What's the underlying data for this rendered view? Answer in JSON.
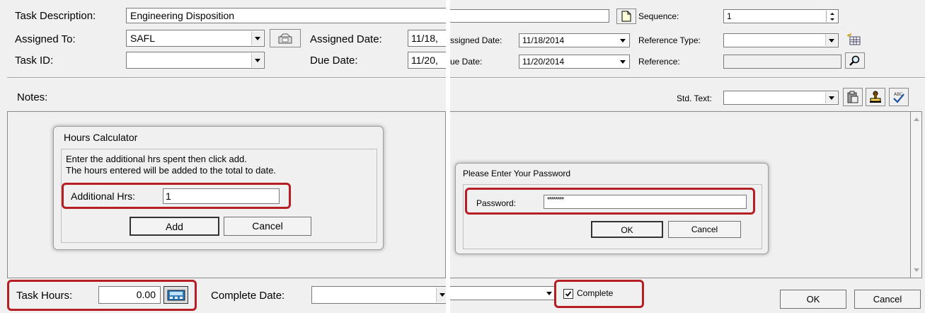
{
  "left": {
    "task_description_label": "Task Description:",
    "task_description_value": "Engineering Disposition",
    "assigned_to_label": "Assigned To:",
    "assigned_to_value": "SAFL",
    "assigned_date_label": "Assigned Date:",
    "assigned_date_value": "11/18,",
    "task_id_label": "Task ID:",
    "task_id_value": "",
    "due_date_label": "Due Date:",
    "due_date_value": "11/20,",
    "notes_label": "Notes:",
    "task_hours_label": "Task Hours:",
    "task_hours_value": "0.00",
    "complete_date_label": "Complete Date:",
    "complete_date_value": ""
  },
  "hours_calculator": {
    "title": "Hours Calculator",
    "instructions_line1": "Enter the additional hrs spent then click add.",
    "instructions_line2": "The hours entered will be added to the total to date.",
    "additional_hrs_label": "Additional Hrs:",
    "additional_hrs_value": "1",
    "add_button": "Add",
    "cancel_button": "Cancel"
  },
  "right": {
    "sequence_label": "Sequence:",
    "sequence_value": "1",
    "assigned_date_label": "ssigned Date:",
    "assigned_date_value": "11/18/2014",
    "reference_type_label": "Reference Type:",
    "reference_type_value": "",
    "due_date_label": "ue Date:",
    "due_date_value": "11/20/2014",
    "reference_label": "Reference:",
    "reference_value": "",
    "std_text_label": "Std. Text:",
    "std_text_value": "",
    "complete_checkbox_label": "Complete",
    "complete_checked": true,
    "ok_button": "OK",
    "cancel_button": "Cancel"
  },
  "password_dialog": {
    "title": "Please Enter Your Password",
    "password_label": "Password:",
    "password_value": "********",
    "ok_button": "OK",
    "cancel_button": "Cancel"
  },
  "colors": {
    "highlight": "#b51e23",
    "panel_bg": "#f0f0f0"
  },
  "icons": [
    "document-icon",
    "phone-icon",
    "calendar-table-icon",
    "search-icon",
    "clipboard-icon",
    "stamp-icon",
    "spellcheck-icon",
    "calculator-icon",
    "scroll-up-icon",
    "scroll-down-icon",
    "checkmark-icon"
  ]
}
